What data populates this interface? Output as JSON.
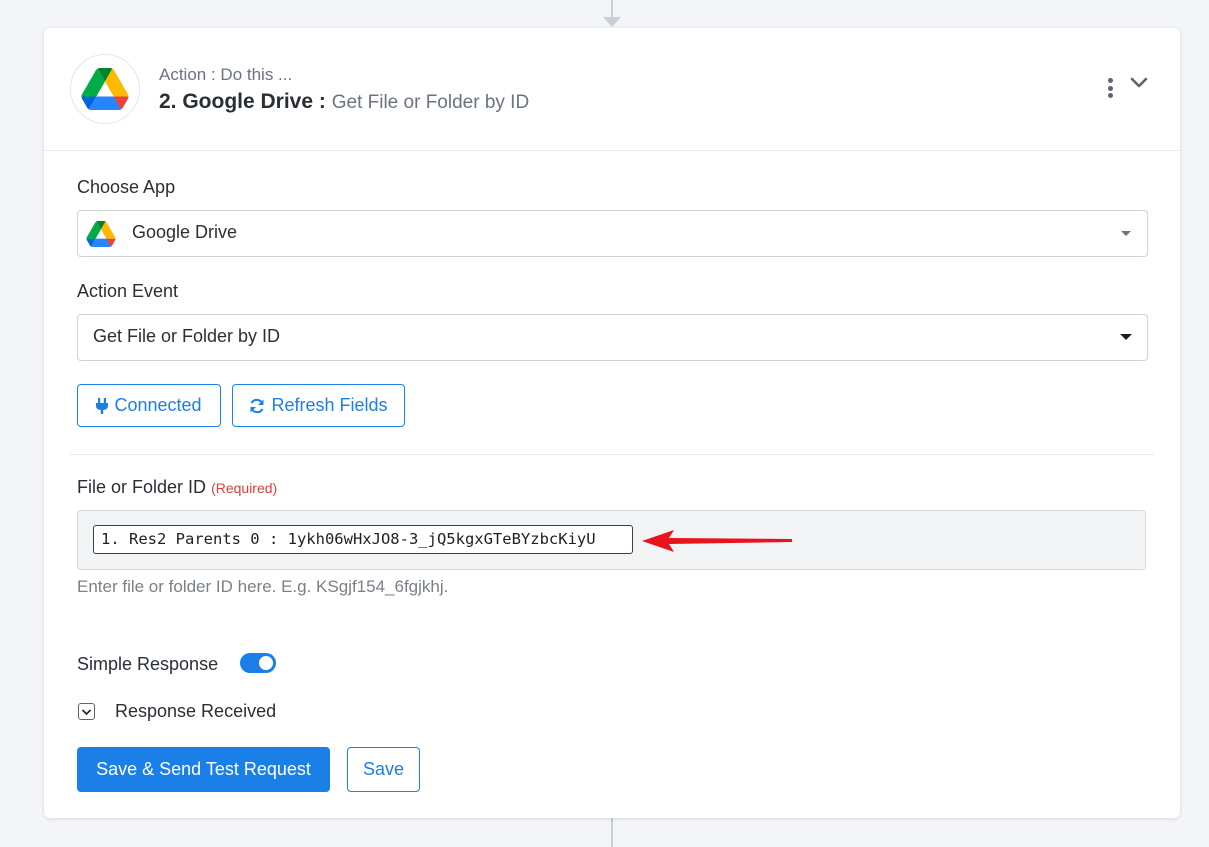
{
  "header": {
    "subtitle": "Action : Do this ...",
    "step_title": "2. Google Drive :",
    "step_event": "Get File or Folder by ID",
    "logo_icon": "google-drive-icon",
    "menu_icon": "kebab-menu-icon",
    "collapse_icon": "chevron-down-icon"
  },
  "choose_app": {
    "label": "Choose App",
    "value": "Google Drive",
    "icon": "google-drive-icon"
  },
  "action_event": {
    "label": "Action Event",
    "value": "Get File or Folder by ID"
  },
  "buttons": {
    "connected": "Connected",
    "refresh_fields": "Refresh Fields",
    "save_send": "Save & Send Test Request",
    "save": "Save"
  },
  "file_field": {
    "label": "File or Folder ID",
    "required": "(Required)",
    "token": "1. Res2 Parents 0 : 1ykh06wHxJO8-3_jQ5kgxGTeBYzbcKiyU",
    "help": "Enter file or folder ID here. E.g. KSgjf154_6fgjkhj."
  },
  "simple_response": {
    "label": "Simple Response",
    "enabled": true
  },
  "response_received": {
    "label": "Response Received"
  },
  "colors": {
    "primary": "#1a7fe6",
    "required": "#d9413c",
    "annotation_arrow": "#e8141b"
  }
}
